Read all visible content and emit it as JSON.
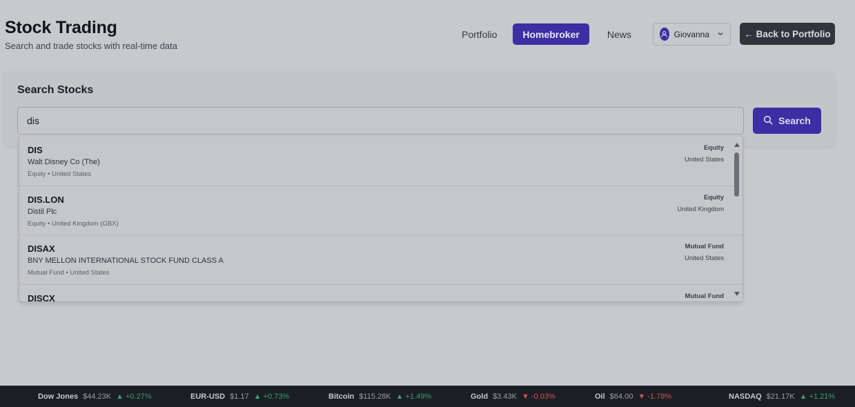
{
  "header": {
    "title": "Stock Trading",
    "subtitle": "Search and trade stocks with real-time data"
  },
  "nav": {
    "items": [
      {
        "label": "Portfolio",
        "active": false
      },
      {
        "label": "Homebroker",
        "active": true
      },
      {
        "label": "News",
        "active": false
      }
    ]
  },
  "user": {
    "name": "Giovanna",
    "avatar_icon": "user-icon"
  },
  "back_button": {
    "label": "← Back to Portfolio"
  },
  "search": {
    "card_title": "Search Stocks",
    "query": "dis",
    "button_label": "Search",
    "button_icon": "search-icon"
  },
  "results": [
    {
      "symbol": "DIS",
      "name": "Walt Disney Co (The)",
      "meta": "Equity • United States",
      "type": "Equity",
      "country": "United States"
    },
    {
      "symbol": "DIS.LON",
      "name": "Distil Plc",
      "meta": "Equity • United Kingdom (GBX)",
      "type": "Equity",
      "country": "United Kingdom"
    },
    {
      "symbol": "DISAX",
      "name": "BNY MELLON INTERNATIONAL STOCK FUND CLASS A",
      "meta": "Mutual Fund • United States",
      "type": "Mutual Fund",
      "country": "United States"
    },
    {
      "symbol": "DISCX",
      "name": "",
      "meta": "",
      "type": "Mutual Fund",
      "country": ""
    }
  ],
  "ticker": [
    {
      "name": "Dow Jones",
      "price": "$44.23K",
      "change": "▲ +0.27%",
      "direction": "up"
    },
    {
      "name": "EUR-USD",
      "price": "$1.17",
      "change": "▲ +0.73%",
      "direction": "up"
    },
    {
      "name": "Bitcoin",
      "price": "$115.28K",
      "change": "▲ +1.49%",
      "direction": "up"
    },
    {
      "name": "Gold",
      "price": "$3.43K",
      "change": "▼ -0.03%",
      "direction": "down"
    },
    {
      "name": "Oil",
      "price": "$64.00",
      "change": "▼ -1.78%",
      "direction": "down"
    },
    {
      "name": "NASDAQ",
      "price": "$21.17K",
      "change": "▲ +1.21%",
      "direction": "up"
    }
  ],
  "colors": {
    "accent": "#3b2fa3",
    "ticker_up": "#38a169",
    "ticker_down": "#d35450"
  }
}
